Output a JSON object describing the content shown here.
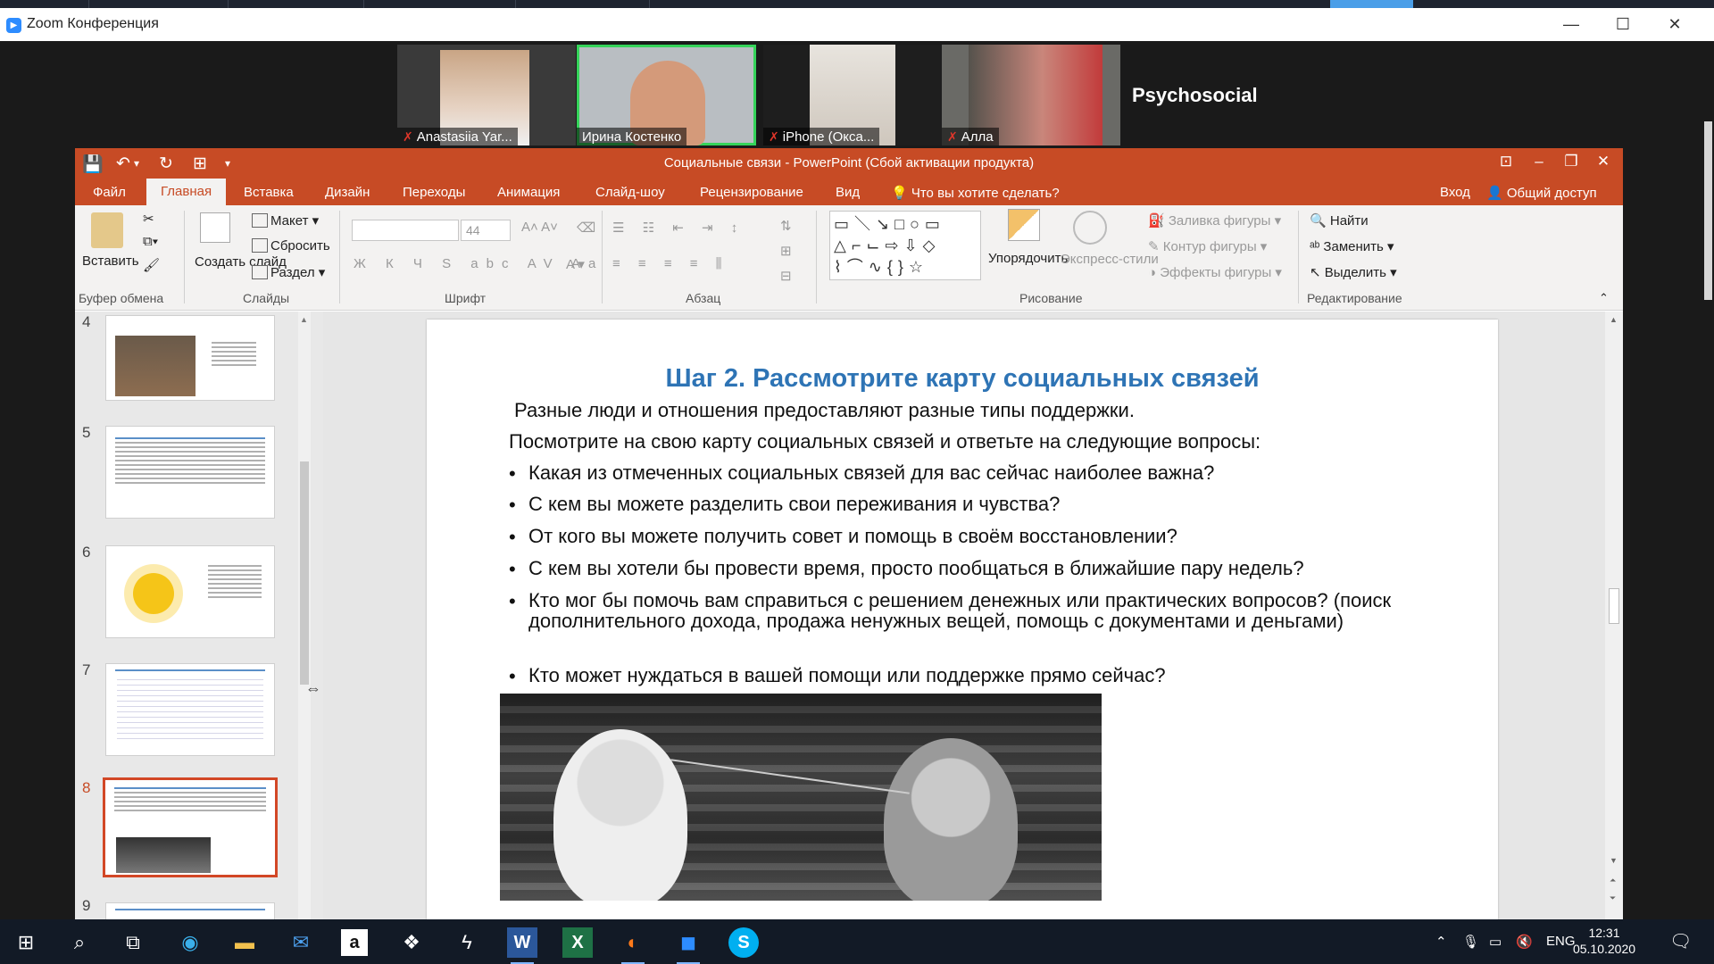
{
  "zoom": {
    "title": "Zoom Конференция",
    "participants": [
      {
        "name": "Anastasiia Yar...",
        "muted": true
      },
      {
        "name": "Ирина Костенко",
        "muted": false,
        "active": true
      },
      {
        "name": "iPhone (Окса...",
        "muted": true
      },
      {
        "name": "Алла",
        "muted": true
      }
    ],
    "name_tile": "Psychosocial su..."
  },
  "ppt": {
    "title": "Социальные связи - PowerPoint (Сбой активации продукта)",
    "tabs": [
      "Файл",
      "Главная",
      "Вставка",
      "Дизайн",
      "Переходы",
      "Анимация",
      "Слайд-шоу",
      "Рецензирование",
      "Вид"
    ],
    "tell_me": "Что вы хотите сделать?",
    "signin": "Вход",
    "share": "Общий доступ",
    "ribbon": {
      "paste": "Вставить",
      "new_slide": "Создать слайд",
      "layout": "Макет",
      "reset": "Сбросить",
      "section": "Раздел",
      "font_size": "44",
      "arrange": "Упорядочить",
      "quick_styles": "Экспресс-стили",
      "shape_fill": "Заливка фигуры",
      "shape_outline": "Контур фигуры",
      "shape_effects": "Эффекты фигуры",
      "find": "Найти",
      "replace": "Заменить",
      "select": "Выделить",
      "groups": {
        "clipboard": "Буфер обмена",
        "slides": "Слайды",
        "font": "Шрифт",
        "paragraph": "Абзац",
        "drawing": "Рисование",
        "editing": "Редактирование"
      }
    },
    "thumb_numbers": [
      "4",
      "5",
      "6",
      "7",
      "8",
      "9"
    ],
    "slide": {
      "title": "Шаг 2. Рассмотрите карту социальных связей",
      "line1": "Разные люди и отношения предоставляют разные типы поддержки.",
      "line2": "Посмотрите на свою карту социальных связей и ответьте на следующие вопросы:",
      "bullets": [
        "Какая из отмеченных социальных связей для вас сейчас наиболее важна?",
        "С кем вы можете разделить свои переживания и чувства?",
        "От кого вы можете получить совет и помощь в своём восстановлении?",
        "С кем вы хотели бы провести время, просто пообщаться в ближайшие пару недель?",
        "Кто мог бы помочь вам справиться с решением денежных или практических вопросов? (поиск дополнительного дохода, продажа ненужных вещей, помощь с документами и деньгами)",
        "Кто может нуждаться в вашей помощи или поддержке прямо сейчас?"
      ]
    }
  },
  "taskbar": {
    "lang": "ENG",
    "time": "12:31",
    "date": "05.10.2020"
  }
}
